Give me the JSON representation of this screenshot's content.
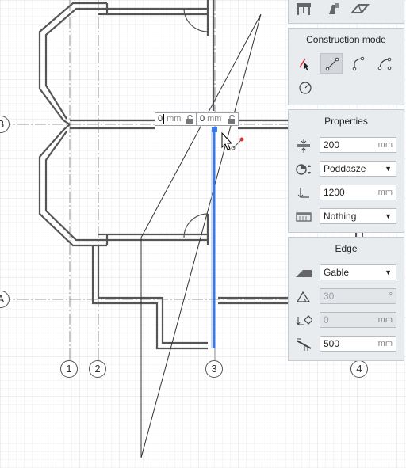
{
  "drawing": {
    "axis_labels": [
      "1",
      "2",
      "3",
      "4"
    ],
    "row_labels": [
      "B",
      "A"
    ],
    "edit_length_value": "0",
    "edit_length_unit": "mm",
    "edit_angle_value": "0",
    "edit_angle_unit": "mm"
  },
  "construction_mode": {
    "title": "Construction mode",
    "tools": [
      "wall-pick-icon",
      "line-icon",
      "polyline-arc-icon",
      "arc-icon",
      "circle-icon"
    ],
    "active_tool": "line-icon"
  },
  "properties": {
    "title": "Properties",
    "thickness_value": "200",
    "thickness_unit": "mm",
    "level_value": "Poddasze",
    "height_value": "1200",
    "height_unit": "mm",
    "material_value": "Nothing"
  },
  "edge": {
    "title": "Edge",
    "type_value": "Gable",
    "angle_value": "30",
    "angle_unit": "°",
    "offset_value": "0",
    "offset_unit": "mm",
    "overhang_value": "500",
    "overhang_unit": "mm"
  },
  "colors": {
    "selection": "#3b78e7",
    "panel_bg": "#e9ecef",
    "grid": "#e4e6e8",
    "wall": "#555555",
    "snap_red": "#e03030"
  }
}
